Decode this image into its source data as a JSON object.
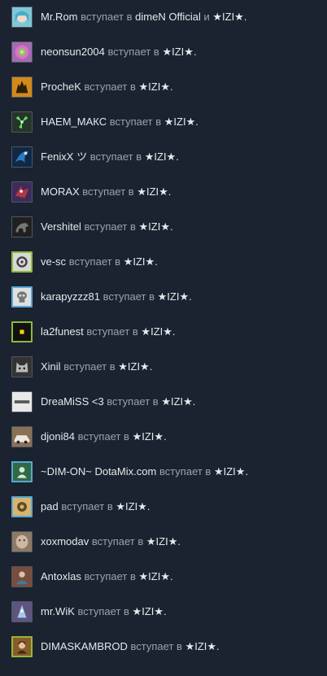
{
  "feed": {
    "action_text": "вступает в",
    "and_text": "и",
    "items": [
      {
        "user": "Mr.Rom",
        "group": "dimeN Official",
        "group2": "★IZI★.",
        "avatar": "anime-girl-icon",
        "color": "#7fc7d8",
        "ring": ""
      },
      {
        "user": "neonsun2004",
        "group": "★IZI★.",
        "avatar": "psychedelic-icon",
        "color": "#a46bb4",
        "ring": ""
      },
      {
        "user": "ProcheK",
        "group": "★IZI★.",
        "avatar": "wolf-icon",
        "color": "#d28a1a",
        "ring": ""
      },
      {
        "user": "НАЕМ_МАКС",
        "group": "★IZI★.",
        "avatar": "radiation-icon",
        "color": "#25352a",
        "ring": ""
      },
      {
        "user": "FenixX ツ",
        "group": "★IZI★.",
        "avatar": "blue-fenix-icon",
        "color": "#2d79c0",
        "ring": ""
      },
      {
        "user": "MORAX",
        "group": "★IZI★.",
        "avatar": "dragon-icon",
        "color": "#3e2b5a",
        "ring": ""
      },
      {
        "user": "Vershitel",
        "group": "★IZI★.",
        "avatar": "lion-icon",
        "color": "#202020",
        "ring": ""
      },
      {
        "user": "ve-sc",
        "group": "★IZI★.",
        "avatar": "portal-icon",
        "color": "#d8d8d8",
        "ring": "ingame"
      },
      {
        "user": "karapyzzz81",
        "group": "★IZI★.",
        "avatar": "skull-icon",
        "color": "#e0e0e0",
        "ring": "online"
      },
      {
        "user": "la2funest",
        "group": "★IZI★.",
        "avatar": "yellow-square-icon",
        "color": "#111111",
        "ring": "ingame"
      },
      {
        "user": "Xinil",
        "group": "★IZI★.",
        "avatar": "cat-icon",
        "color": "#333333",
        "ring": ""
      },
      {
        "user": "DreaMiSS <3",
        "group": "★IZI★.",
        "avatar": "dreamiss-logo-icon",
        "color": "#e8e8e8",
        "ring": ""
      },
      {
        "user": "djoni84",
        "group": "★IZI★.",
        "avatar": "car-icon",
        "color": "#8a7058",
        "ring": ""
      },
      {
        "user": "~DIM-ON~ DotaMix.com",
        "group": "★IZI★.",
        "avatar": "dotamix-icon",
        "color": "#2f6a44",
        "ring": "online"
      },
      {
        "user": "pad",
        "group": "★IZI★.",
        "avatar": "gear-icon",
        "color": "#d9b46b",
        "ring": "online"
      },
      {
        "user": "xoxmodav",
        "group": "★IZI★.",
        "avatar": "face-icon",
        "color": "#8c7a68",
        "ring": ""
      },
      {
        "user": "Antoxlas",
        "group": "★IZI★.",
        "avatar": "character-icon",
        "color": "#7a4c3d",
        "ring": ""
      },
      {
        "user": "mr.WiK",
        "group": "★IZI★.",
        "avatar": "mage-icon",
        "color": "#5e5480",
        "ring": ""
      },
      {
        "user": "DIMASKAMBROD",
        "group": "★IZI★.",
        "avatar": "woman-portrait-icon",
        "color": "#8b5a2b",
        "ring": "ingame"
      }
    ]
  }
}
